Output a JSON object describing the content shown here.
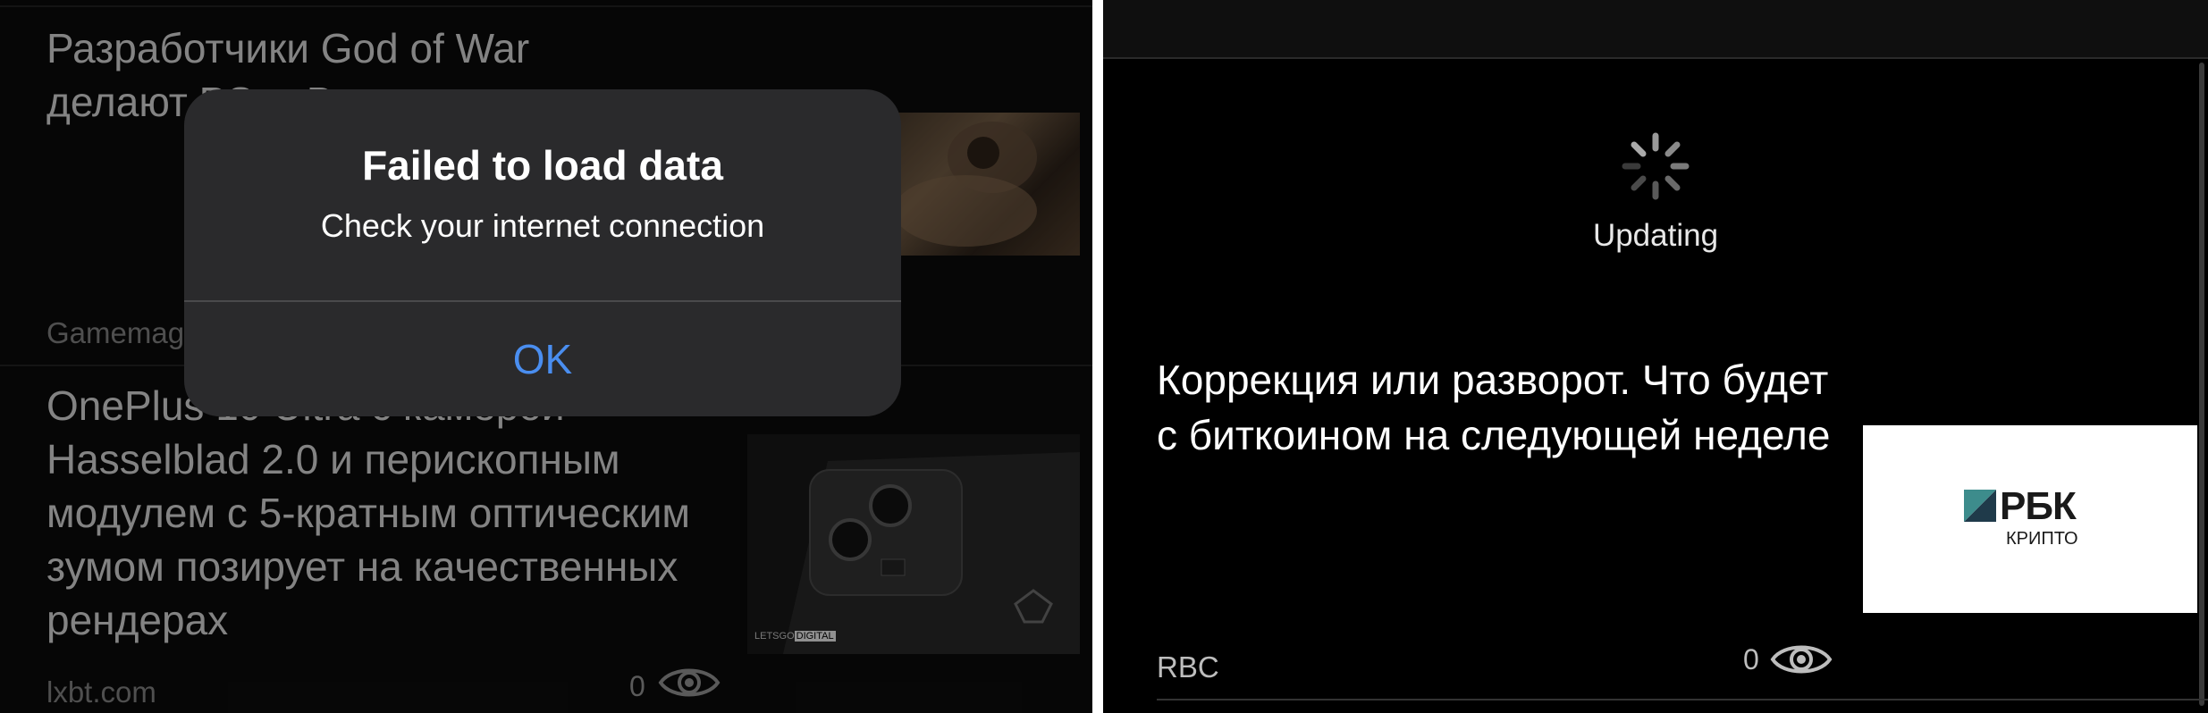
{
  "left": {
    "article1": {
      "title": "Разработчики God of War делают PS… Вышел…",
      "source": "Gamemag"
    },
    "article2": {
      "title": "OnePlus 10 Ultra с камерой Hasselblad 2.0 и перископным модулем с 5-кратным оптическим зумом позирует на качественных рендерах",
      "source": "lxbt.com",
      "views": "0",
      "watermark_line1": "LETSGO",
      "watermark_line2": "DIGITAL"
    },
    "alert": {
      "title": "Failed to load data",
      "message": "Check your internet connection",
      "ok_label": "OK"
    }
  },
  "right": {
    "status": "Updating",
    "article": {
      "title": "Коррекция или разворот. Что будет с биткоином на следующей неделе",
      "source": "RBC",
      "views": "0",
      "logo_text": "РБК",
      "logo_subtext": "КРИПТО"
    }
  },
  "colors": {
    "alert_bg": "#2a2a2c",
    "alert_button": "#4a8ef0",
    "rbk_logo_dark": "#1f3a4a",
    "rbk_logo_teal": "#3d8c8c"
  },
  "icons": [
    "eye-icon",
    "spinner-icon",
    "rbk-logo"
  ]
}
